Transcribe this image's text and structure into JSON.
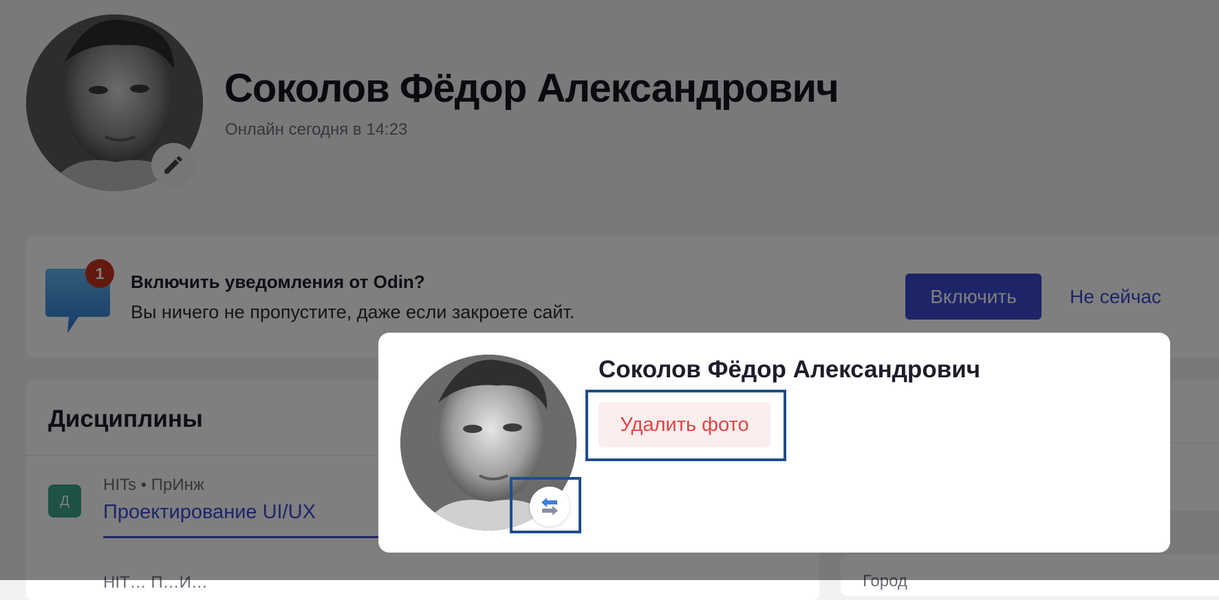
{
  "profile": {
    "name": "Соколов Фёдор Александрович",
    "online": "Онлайн сегодня в 14:23"
  },
  "notification": {
    "badge": "1",
    "title": "Включить уведомления от Odin?",
    "text": "Вы ничего не пропустите, даже если закроете сайт.",
    "enable_label": "Включить",
    "not_now_label": "Не сейчас"
  },
  "disciplines": {
    "title": "Дисциплины",
    "items": [
      {
        "badge": "Д",
        "meta": "HITs • ПрИнж",
        "name": "Проектирование UI/UX"
      },
      {
        "meta": "HIT… П…И…"
      }
    ]
  },
  "side": {
    "partial_label": "Город"
  },
  "photo_modal": {
    "name": "Соколов Фёдор Александрович",
    "delete_label": "Удалить фото"
  },
  "colors": {
    "accent": "#3a4ad1",
    "danger": "#e14444",
    "danger_bg": "#fdeeee",
    "highlight": "#1f4e8c",
    "badge_green": "#3aa58a",
    "notif_red": "#c8321e"
  },
  "icons": {
    "edit": "pencil-icon",
    "swap": "swap-arrows-icon",
    "notification": "speech-bubble-icon"
  }
}
